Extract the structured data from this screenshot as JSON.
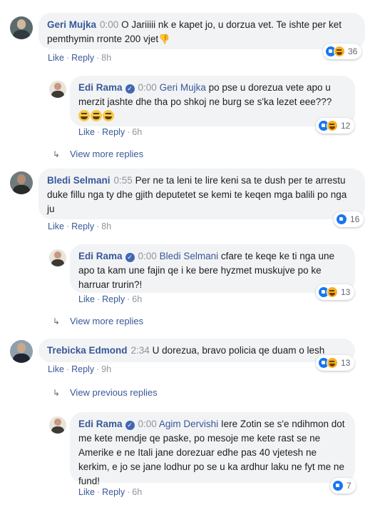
{
  "comments": [
    {
      "author": "Geri Mujka",
      "timestamp": "0:00",
      "text": "O Jariiiii nk e kapet jo, u dorzua vet. Te ishte per ket pemthymin rronte 200 vjet",
      "emoji_suffix": "👎",
      "actions": {
        "like": "Like",
        "reply": "Reply",
        "time": "8h"
      },
      "reactions": {
        "count": "36",
        "types": [
          "like",
          "haha"
        ]
      },
      "replies": [
        {
          "author": "Edi Rama",
          "verified": true,
          "timestamp": "0:00",
          "mention": "Geri Mujka",
          "text": "po pse u dorezua vete apo u merzit jashte dhe tha po shkoj ne burg se s'ka lezet eee???",
          "actions": {
            "like": "Like",
            "reply": "Reply",
            "time": "6h"
          },
          "reactions": {
            "count": "12",
            "types": [
              "like",
              "haha"
            ]
          }
        }
      ],
      "view_more": "View more replies"
    },
    {
      "author": "Bledi Selmani",
      "timestamp": "0:55",
      "text": "Per ne ta leni te lire keni sa te dush per te arrestu duke fillu nga ty dhe gjith deputetet se kemi te keqen mga balili po nga ju",
      "actions": {
        "like": "Like",
        "reply": "Reply",
        "time": "8h"
      },
      "reactions": {
        "count": "16",
        "types": [
          "like"
        ]
      },
      "replies": [
        {
          "author": "Edi Rama",
          "verified": true,
          "timestamp": "0:00",
          "mention": "Bledi Selmani",
          "text": "cfare te keqe ke ti nga une apo ta kam une fajin qe i ke bere hyzmet muskujve po ke harruar trurin?!",
          "actions": {
            "like": "Like",
            "reply": "Reply",
            "time": "6h"
          },
          "reactions": {
            "count": "13",
            "types": [
              "like",
              "haha"
            ]
          }
        }
      ],
      "view_more": "View more replies"
    },
    {
      "author": "Trebicka Edmond",
      "timestamp": "2:34",
      "text": "U dorezua, bravo policia qe duam o lesh",
      "actions": {
        "like": "Like",
        "reply": "Reply",
        "time": "9h"
      },
      "reactions": {
        "count": "13",
        "types": [
          "like",
          "haha"
        ]
      },
      "view_previous": "View previous replies",
      "replies": [
        {
          "author": "Edi Rama",
          "verified": true,
          "timestamp": "0:00",
          "mention": "Agim Dervishi",
          "text": "Iere Zotin se s'e ndihmon dot me kete mendje qe paske, po mesoje me kete rast se ne Amerike e ne Itali jane dorezuar edhe pas 40 vjetesh ne kerkim, e jo se jane lodhur po se u ka ardhur laku ne fyt me ne fund!",
          "actions": {
            "like": "Like",
            "reply": "Reply",
            "time": "6h"
          },
          "reactions": {
            "count": "7",
            "types": [
              "like"
            ]
          }
        }
      ]
    }
  ],
  "colors": {
    "link": "#385898",
    "bubble": "#f2f3f5",
    "muted": "#90949c",
    "like": "#1877f2",
    "haha": "#f7b125"
  },
  "icons": {
    "verified": "verified-badge-icon",
    "reply_arrow": "reply-arrow-icon",
    "like": "like-reaction-icon",
    "haha": "haha-reaction-icon"
  }
}
